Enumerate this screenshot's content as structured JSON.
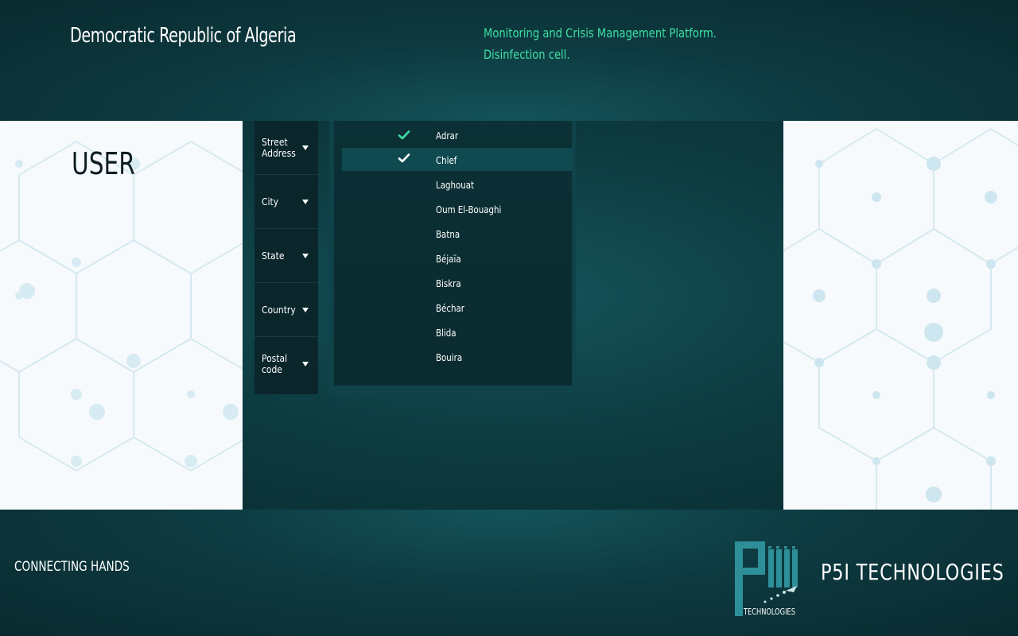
{
  "header": {
    "country_title": "Democratic Republic of Algeria",
    "platform_title": "Monitoring and Crisis Management Platform.",
    "platform_subtitle": "Disinfection cell."
  },
  "user_panel": {
    "label": "USER"
  },
  "fields": [
    {
      "label": "Street Address",
      "icon": "caret-down-icon"
    },
    {
      "label": "City",
      "icon": "caret-down-icon"
    },
    {
      "label": "State",
      "icon": "caret-down-icon"
    },
    {
      "label": "Country",
      "icon": "caret-down-icon"
    },
    {
      "label": "Postal code",
      "icon": "caret-down-icon"
    }
  ],
  "dropdown": {
    "items": [
      {
        "label": "Adrar",
        "checked": true,
        "highlighted": false
      },
      {
        "label": "Chlef",
        "checked": true,
        "highlighted": true
      },
      {
        "label": "Laghouat",
        "checked": false,
        "highlighted": false
      },
      {
        "label": "Oum El-Bouaghi",
        "checked": false,
        "highlighted": false
      },
      {
        "label": "Batna",
        "checked": false,
        "highlighted": false
      },
      {
        "label": "Béjaïa",
        "checked": false,
        "highlighted": false
      },
      {
        "label": "Biskra",
        "checked": false,
        "highlighted": false
      },
      {
        "label": "Béchar",
        "checked": false,
        "highlighted": false
      },
      {
        "label": "Blida",
        "checked": false,
        "highlighted": false
      },
      {
        "label": "Bouira",
        "checked": false,
        "highlighted": false
      }
    ]
  },
  "footer": {
    "tagline": "CONNECTING HANDS",
    "company": "P5I TECHNOLOGIES",
    "logo_text": "TECHNOLOGIES"
  },
  "colors": {
    "accent_green": "#3fe0a5",
    "panel_dark": "#0a262b",
    "highlight_row": "#0f4a51",
    "logo_teal": "#2f8f99"
  }
}
